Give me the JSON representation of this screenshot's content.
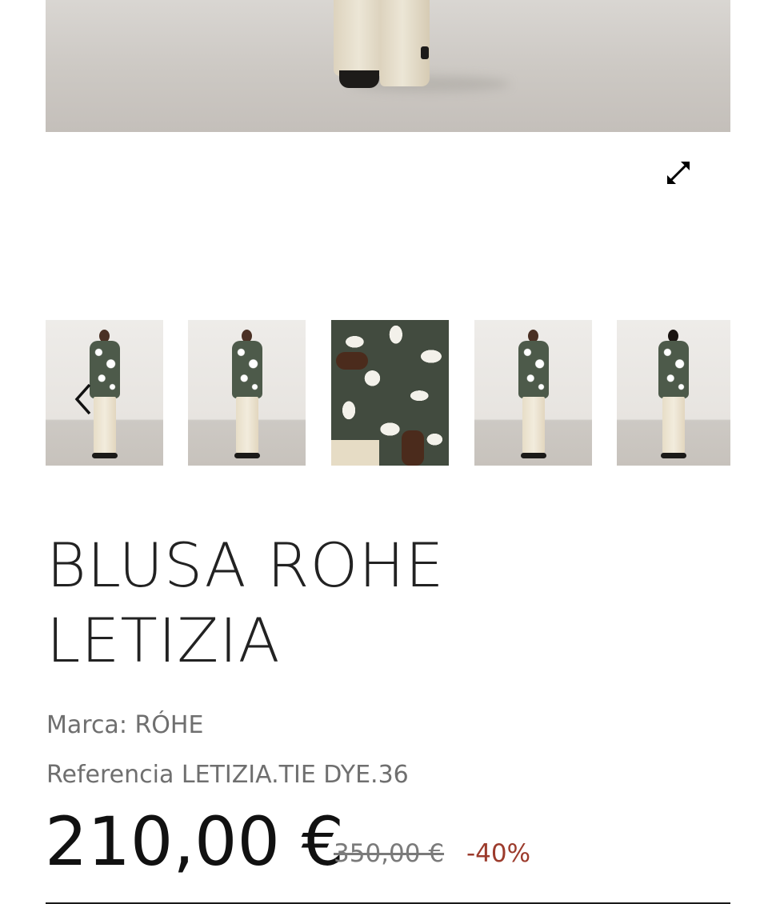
{
  "gallery": {
    "main_image_alt": "",
    "expand_icon": "expand-arrows-icon",
    "prev_icon": "chevron-left-icon",
    "thumbnails": [
      {
        "kind": "full-body-front"
      },
      {
        "kind": "full-body-three-quarter"
      },
      {
        "kind": "closeup-print"
      },
      {
        "kind": "full-body-side"
      },
      {
        "kind": "full-body-back"
      }
    ]
  },
  "product": {
    "title_line1": "BLUSA ROHE",
    "title_line2": "LETIZIA",
    "brand": "Marca: RÓHE",
    "reference": "Referencia LETIZIA.TIE DYE.36",
    "price": "210,00 €",
    "old_price": "350,00 €",
    "discount": "-40%"
  },
  "colors": {
    "text": "#222222",
    "muted": "#6f6f6f",
    "discount": "#9c3b2c"
  }
}
